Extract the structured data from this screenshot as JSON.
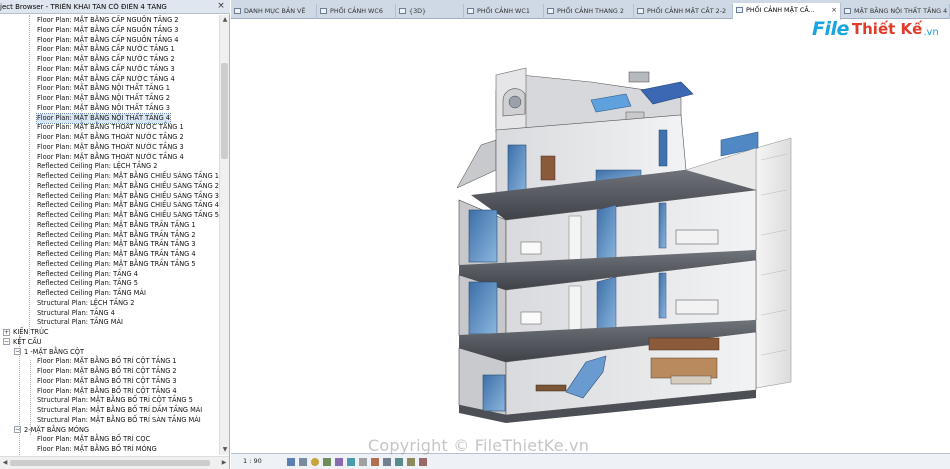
{
  "browser": {
    "title": "ject Browser - TRIỂN KHAI TÂN CỔ ĐIỂN 4 TẦNG",
    "close": "×",
    "rows": [
      {
        "text": "Floor Plan: MẶT BẰNG CẤP NGUỒN TẦNG 2",
        "level": 3
      },
      {
        "text": "Floor Plan: MẶT BẰNG CẤP NGUỒN TẦNG 3",
        "level": 3
      },
      {
        "text": "Floor Plan: MẶT BẰNG CẤP NGUỒN TẦNG 4",
        "level": 3
      },
      {
        "text": "Floor Plan: MẶT BẰNG CẤP NƯỚC TẦNG 1",
        "level": 3
      },
      {
        "text": "Floor Plan: MẶT BẰNG CẤP NƯỚC TẦNG 2",
        "level": 3
      },
      {
        "text": "Floor Plan: MẶT BẰNG CẤP NƯỚC TẦNG 3",
        "level": 3
      },
      {
        "text": "Floor Plan: MẶT BẰNG CẤP NƯỚC TẦNG 4",
        "level": 3
      },
      {
        "text": "Floor Plan: MẶT BẰNG NỘI THẤT TẦNG 1",
        "level": 3
      },
      {
        "text": "Floor Plan: MẶT BẰNG NỘI THẤT TẦNG 2",
        "level": 3
      },
      {
        "text": "Floor Plan: MẶT BẰNG NỘI THẤT TẦNG 3",
        "level": 3
      },
      {
        "text": "Floor Plan: MẶT BẰNG NỘI THẤT TẦNG 4",
        "level": 3,
        "selected": true
      },
      {
        "text": "Floor Plan: MẶT BẰNG THOÁT NƯỚC TẦNG 1",
        "level": 3
      },
      {
        "text": "Floor Plan: MẶT BẰNG THOÁT NƯỚC TẦNG 2",
        "level": 3
      },
      {
        "text": "Floor Plan: MẶT BẰNG THOÁT NƯỚC TẦNG 3",
        "level": 3
      },
      {
        "text": "Floor Plan: MẶT BẰNG THOÁT NƯỚC TẦNG 4",
        "level": 3
      },
      {
        "text": "Reflected Ceiling Plan: LỆCH TẦNG 2",
        "level": 3
      },
      {
        "text": "Reflected Ceiling Plan: MẶT BẰNG CHIẾU SÁNG TẦNG 1",
        "level": 3
      },
      {
        "text": "Reflected Ceiling Plan: MẶT BẰNG CHIẾU SÁNG TẦNG 2",
        "level": 3
      },
      {
        "text": "Reflected Ceiling Plan: MẶT BẰNG CHIẾU SÁNG TẦNG 3",
        "level": 3
      },
      {
        "text": "Reflected Ceiling Plan: MẶT BẰNG CHIẾU SÁNG TẦNG 4",
        "level": 3
      },
      {
        "text": "Reflected Ceiling Plan: MẶT BẰNG CHIẾU SÁNG TẦNG 5",
        "level": 3
      },
      {
        "text": "Reflected Ceiling Plan: MẶT BẰNG TRẦN TẦNG 1",
        "level": 3
      },
      {
        "text": "Reflected Ceiling Plan: MẶT BẰNG TRẦN TẦNG 2",
        "level": 3
      },
      {
        "text": "Reflected Ceiling Plan: MẶT BẰNG TRẦN TẦNG 3",
        "level": 3
      },
      {
        "text": "Reflected Ceiling Plan: MẶT BẰNG TRẦN TẦNG 4",
        "level": 3
      },
      {
        "text": "Reflected Ceiling Plan: MẶT BẰNG TRẦN TẦNG 5",
        "level": 3
      },
      {
        "text": "Reflected Ceiling Plan: TẦNG 4",
        "level": 3
      },
      {
        "text": "Reflected Ceiling Plan: TẦNG 5",
        "level": 3
      },
      {
        "text": "Reflected Ceiling Plan: TẦNG MÁI",
        "level": 3
      },
      {
        "text": "Structural Plan: LỆCH TẦNG 2",
        "level": 3
      },
      {
        "text": "Structural Plan: TẦNG 4",
        "level": 3
      },
      {
        "text": "Structural Plan: TẦNG MÁI",
        "level": 3
      },
      {
        "text": "KIẾN TRÚC",
        "level": 1,
        "toggle": "+"
      },
      {
        "text": "KẾT CẤU",
        "level": 1,
        "toggle": "−"
      },
      {
        "text": "1 -MẶT BẰNG CỘT",
        "level": 2,
        "toggle": "−"
      },
      {
        "text": "Floor Plan: MẶT BẰNG BỐ TRÍ CỘT TẦNG 1",
        "level": 3
      },
      {
        "text": "Floor Plan: MẶT BẰNG BỐ TRÍ CỘT TẦNG 2",
        "level": 3
      },
      {
        "text": "Floor Plan: MẶT BẰNG BỐ TRÍ CỘT TẦNG 3",
        "level": 3
      },
      {
        "text": "Floor Plan: MẶT BẰNG BỐ TRÍ CỘT TẦNG 4",
        "level": 3
      },
      {
        "text": "Structural Plan: MẶT BẰNG BỐ TRÍ CỘT TẦNG 5",
        "level": 3
      },
      {
        "text": "Structural Plan: MẶT BẰNG BỐ TRÍ DẦM TẦNG MÁI",
        "level": 3
      },
      {
        "text": "Structural Plan: MẶT BẰNG BỐ TRÍ SÀN TẦNG MÁI",
        "level": 3
      },
      {
        "text": "2-MẶT BẰNG MÓNG",
        "level": 2,
        "toggle": "−"
      },
      {
        "text": "Floor Plan: MẶT BẰNG BỐ TRÍ CỌC",
        "level": 3
      },
      {
        "text": "Floor Plan: MẶT BẰNG BỐ TRÍ MÓNG",
        "level": 3
      }
    ]
  },
  "tabs": [
    {
      "label": "DANH MỤC BẢN VẼ",
      "active": false
    },
    {
      "label": "PHỐI CẢNH WC6",
      "active": false
    },
    {
      "label": "{3D}",
      "active": false
    },
    {
      "label": "PHỐI CẢNH WC1",
      "active": false
    },
    {
      "label": "PHỐI CẢNH THANG 2",
      "active": false
    },
    {
      "label": "PHỐI CẢNH MẶT CẮT 2-2",
      "active": false
    },
    {
      "label": "PHỐI CẢNH MẶT CẮ...",
      "active": true,
      "close": "×"
    },
    {
      "label": "MẶT BẰNG NỘI THẤT TẦNG 4",
      "active": false
    }
  ],
  "status": {
    "scale": "1 : 90"
  },
  "watermark": {
    "logo_file": "File",
    "logo_thiet": "Thiết Kế",
    "logo_vn": ".vn",
    "copyright": "Copyright © FileThietKe.vn"
  },
  "colors": {
    "accent_blue": "#1aa5e0",
    "accent_red": "#e23b2a",
    "glass": "#5b8fc7",
    "selection": "#d9e6f5"
  }
}
